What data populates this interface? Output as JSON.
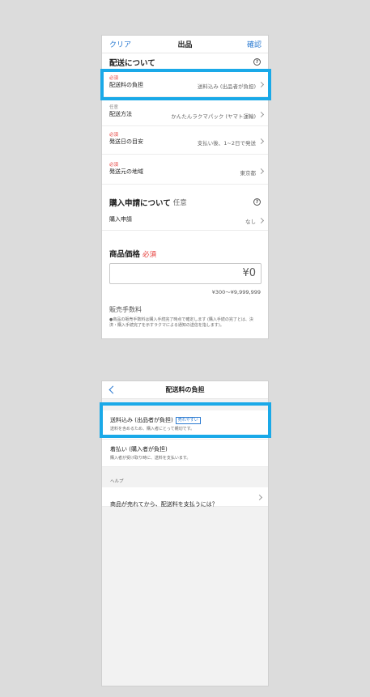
{
  "screen1": {
    "nav": {
      "clear": "クリア",
      "title": "出品",
      "confirm": "確認"
    },
    "shipping_section": {
      "title": "配送について",
      "help": "?"
    },
    "rows": {
      "fee": {
        "tag": "必須",
        "label": "配送料の負担",
        "value": "送料込み (出品者が負担)"
      },
      "method": {
        "tag": "任意",
        "label": "配送方法",
        "value": "かんたんラクマパック (ヤマト運輸)"
      },
      "days": {
        "tag": "必須",
        "label": "発送日の目安",
        "value": "支払い後、1~2日で発送"
      },
      "region": {
        "tag": "必須",
        "label": "発送元の地域",
        "value": "東京都"
      }
    },
    "purchase_section": {
      "title": "購入申請について",
      "optional": "任意",
      "help": "?"
    },
    "purchase_row": {
      "label": "購入申請",
      "value": "なし"
    },
    "price": {
      "title": "商品価格",
      "required": "必須",
      "value": "¥0",
      "range": "¥300～¥9,999,999",
      "fee_title": "販売手数料",
      "note": "●商品の販売手数料は購入手続完了時点で確定します (購入手続の完了とは、決済・購入手続完了を示すラクマによる通知の送信を指します)。"
    }
  },
  "screen2": {
    "nav": {
      "title": "配送料の負担"
    },
    "options": [
      {
        "title": "送料込み (出品者が負担)",
        "badge": "売れやすい",
        "desc": "送料を含めるため、購入者にとって親切です。"
      },
      {
        "title": "着払い (購入者が負担)",
        "desc": "購入者が受け取り時に、送料を支払います。"
      }
    ],
    "help_header": "ヘルプ",
    "help_item": "商品が売れてから、配送料を支払うには？"
  },
  "colors": {
    "highlight": "#1aa9e8",
    "link": "#2a7ad1",
    "required": "#e53935"
  }
}
